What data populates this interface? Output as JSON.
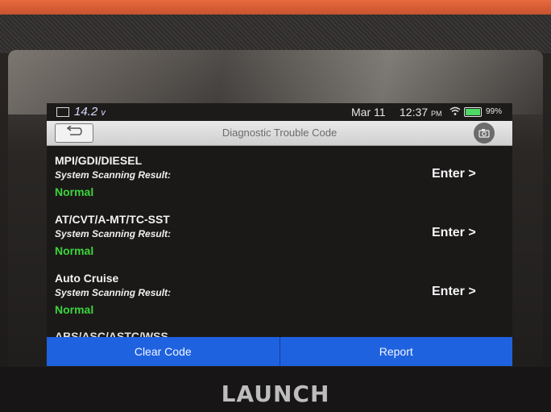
{
  "status_bar": {
    "voltage": "14.2",
    "voltage_unit": "v",
    "date": "Mar 11",
    "time": "12:37",
    "ampm": "PM",
    "battery_percent": "99%",
    "battery_level": 0.99,
    "icons": [
      "battery-icon",
      "wifi-icon",
      "battery-level-icon"
    ]
  },
  "header": {
    "title": "Diagnostic Trouble Code",
    "back_icon": "back-arrow-icon",
    "camera_icon": "camera-icon"
  },
  "systems": [
    {
      "name": "MPI/GDI/DIESEL",
      "scan_label": "System Scanning Result:",
      "status": "Normal",
      "action": "Enter >"
    },
    {
      "name": "AT/CVT/A-MT/TC-SST",
      "scan_label": "System Scanning Result:",
      "status": "Normal",
      "action": "Enter >"
    },
    {
      "name": "Auto Cruise",
      "scan_label": "System Scanning Result:",
      "status": "Normal",
      "action": "Enter >"
    }
  ],
  "cut_off_item": "ABS/ASC/ASTC/WSS",
  "footer": {
    "clear_code": "Clear Code",
    "report": "Report"
  },
  "device_brand": "LAUNCH",
  "colors": {
    "status_normal": "#3cd43c",
    "action_bar": "#1f62e0"
  }
}
